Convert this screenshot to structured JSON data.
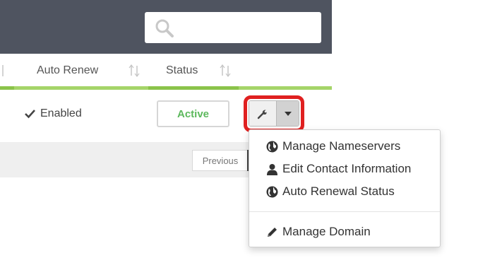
{
  "search": {
    "value": "",
    "icon": "search-icon"
  },
  "table": {
    "columns": [
      {
        "label": "Auto Renew"
      },
      {
        "label": "Status"
      }
    ],
    "row": {
      "auto_renew": "Enabled",
      "status": "Active"
    }
  },
  "actions": {
    "menu": [
      {
        "label": "Manage Nameservers",
        "icon": "globe-icon"
      },
      {
        "label": "Edit Contact Information",
        "icon": "user-icon"
      },
      {
        "label": "Auto Renewal Status",
        "icon": "globe-icon"
      },
      {
        "label": "Manage Domain",
        "icon": "pencil-icon"
      }
    ]
  },
  "pagination": {
    "previous_label": "Previous"
  },
  "colors": {
    "topbar": "#4f5460",
    "accent_green": "#8bc34a",
    "status_green": "#5cb85c",
    "highlight_red": "#e02020"
  }
}
